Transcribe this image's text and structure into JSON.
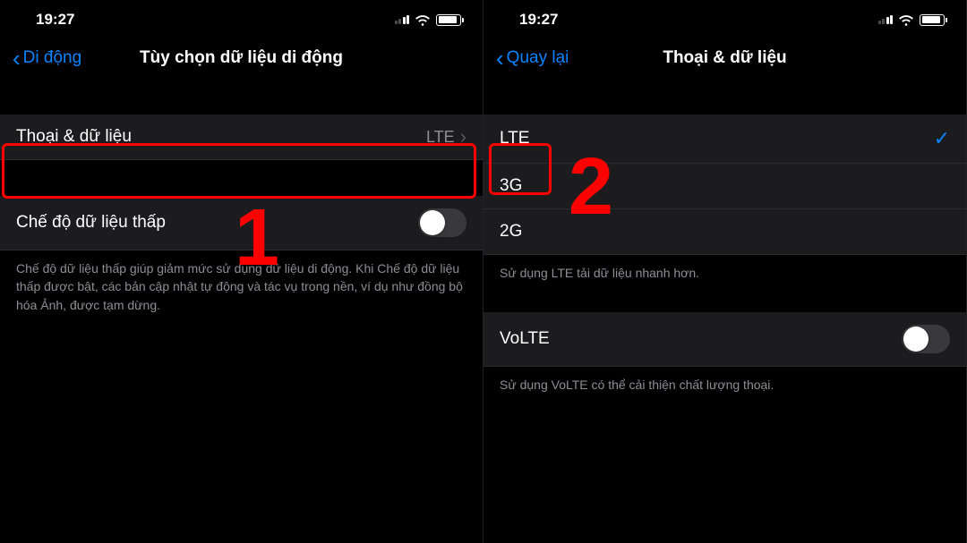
{
  "status": {
    "time": "19:27"
  },
  "screen1": {
    "back": "Di động",
    "title": "Tùy chọn dữ liệu di động",
    "voice_data": {
      "label": "Thoại & dữ liệu",
      "value": "LTE"
    },
    "low_data": {
      "label": "Chế độ dữ liệu thấp"
    },
    "low_data_footer": "Chế độ dữ liệu thấp giúp giảm mức sử dụng dữ liệu di động. Khi Chế độ dữ liệu thấp được bật, các bản cập nhật tự động và tác vụ trong nền, ví dụ như đồng bộ hóa Ảnh, được tạm dừng.",
    "annotation": "1"
  },
  "screen2": {
    "back": "Quay lại",
    "title": "Thoại & dữ liệu",
    "options": [
      {
        "label": "LTE",
        "selected": true
      },
      {
        "label": "3G",
        "selected": false
      },
      {
        "label": "2G",
        "selected": false
      }
    ],
    "lte_footer": "Sử dụng LTE tải dữ liệu nhanh hơn.",
    "volte": {
      "label": "VoLTE"
    },
    "volte_footer": "Sử dụng VoLTE có thể cải thiện chất lượng thoại.",
    "annotation": "2"
  }
}
